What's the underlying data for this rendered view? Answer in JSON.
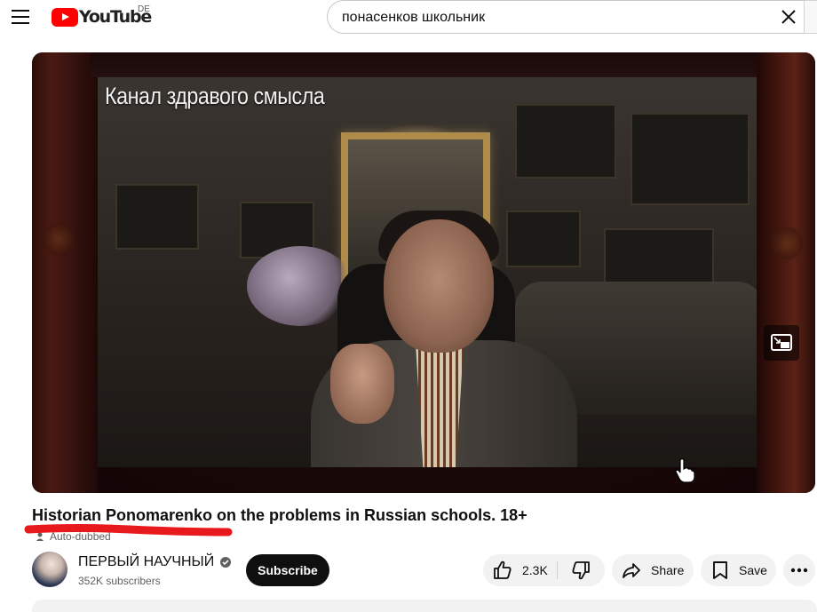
{
  "header": {
    "logo_text": "YouTube",
    "country_code": "DE",
    "search_query": "понасенков школьник",
    "icons": [
      "menu-icon",
      "youtube-logo-icon",
      "clear-search-icon"
    ]
  },
  "player": {
    "caption": "Канал здравого смысла",
    "icons": [
      "miniplayer-icon",
      "hand-cursor-icon"
    ]
  },
  "video": {
    "title": "Historian Ponomarenko on the problems in Russian schools. 18+",
    "auto_dubbed_label": "Auto-dubbed"
  },
  "channel": {
    "name": "ПЕРВЫЙ НАУЧНЫЙ",
    "verified": true,
    "subscribers": "352K subscribers",
    "subscribe_label": "Subscribe"
  },
  "actions": {
    "like_count": "2.3K",
    "share_label": "Share",
    "save_label": "Save"
  },
  "colors": {
    "brand_red": "#ff0000",
    "subscribe_bg": "#0f0f0f",
    "pill_bg": "#f2f2f2",
    "annotation_red": "#e8191c"
  }
}
